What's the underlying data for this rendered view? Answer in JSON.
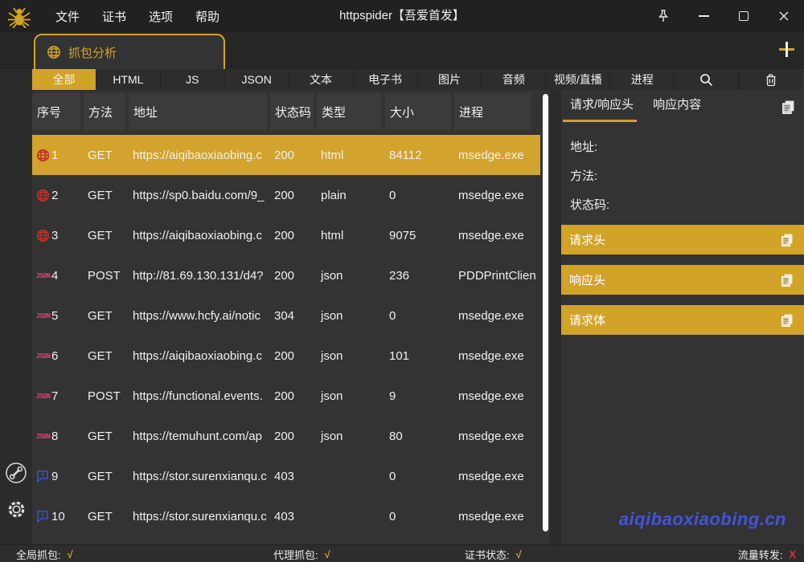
{
  "titlebar": {
    "title": "httpspider【吾爱首发】",
    "menu_items": [
      "文件",
      "证书",
      "选项",
      "帮助"
    ]
  },
  "tabs": {
    "capture_tab": "抓包分析",
    "add_tab": "+"
  },
  "filterbar": {
    "items": [
      "全部",
      "HTML",
      "JS",
      "JSON",
      "文本",
      "电子书",
      "图片",
      "音频",
      "视频/直播",
      "进程"
    ],
    "active": "全部"
  },
  "table": {
    "headers": [
      "序号",
      "方法",
      "地址",
      "状态码",
      "类型",
      "大小",
      "进程"
    ],
    "rows": [
      {
        "icon": "globe",
        "no": "1",
        "method": "GET",
        "url": "https://aiqibaoxiaobing.c",
        "status": "200",
        "type": "html",
        "size": "84112",
        "process": "msedge.exe",
        "selected": true
      },
      {
        "icon": "globe",
        "no": "2",
        "method": "GET",
        "url": "https://sp0.baidu.com/9_",
        "status": "200",
        "type": "plain",
        "size": "0",
        "process": "msedge.exe",
        "selected": false
      },
      {
        "icon": "globe",
        "no": "3",
        "method": "GET",
        "url": "https://aiqibaoxiaobing.c",
        "status": "200",
        "type": "html",
        "size": "9075",
        "process": "msedge.exe",
        "selected": false
      },
      {
        "icon": "json",
        "no": "4",
        "method": "POST",
        "url": "http://81.69.130.131/d4?",
        "status": "200",
        "type": "json",
        "size": "236",
        "process": "PDDPrintClien",
        "selected": false
      },
      {
        "icon": "json",
        "no": "5",
        "method": "GET",
        "url": "https://www.hcfy.ai/notic",
        "status": "304",
        "type": "json",
        "size": "0",
        "process": "msedge.exe",
        "selected": false
      },
      {
        "icon": "json",
        "no": "6",
        "method": "GET",
        "url": "https://aiqibaoxiaobing.c",
        "status": "200",
        "type": "json",
        "size": "101",
        "process": "msedge.exe",
        "selected": false
      },
      {
        "icon": "json",
        "no": "7",
        "method": "POST",
        "url": "https://functional.events.",
        "status": "200",
        "type": "json",
        "size": "9",
        "process": "msedge.exe",
        "selected": false
      },
      {
        "icon": "json",
        "no": "8",
        "method": "GET",
        "url": "https://temuhunt.com/ap",
        "status": "200",
        "type": "json",
        "size": "80",
        "process": "msedge.exe",
        "selected": false
      },
      {
        "icon": "question",
        "no": "9",
        "method": "GET",
        "url": "https://stor.surenxianqu.c",
        "status": "403",
        "type": "",
        "size": "0",
        "process": "msedge.exe",
        "selected": false
      },
      {
        "icon": "question",
        "no": "10",
        "method": "GET",
        "url": "https://stor.surenxianqu.c",
        "status": "403",
        "type": "",
        "size": "0",
        "process": "msedge.exe",
        "selected": false
      }
    ]
  },
  "detail_panel": {
    "tabs": [
      "请求/响应头",
      "响应内容"
    ],
    "active_tab": "请求/响应头",
    "fields": [
      {
        "label": "地址:",
        "value": ""
      },
      {
        "label": "方法:",
        "value": ""
      },
      {
        "label": "状态码:",
        "value": ""
      }
    ],
    "buttons": [
      "请求头",
      "响应头",
      "请求体"
    ],
    "watermark": "aiqibaoxiaobing.cn"
  },
  "statusbar": {
    "items": [
      {
        "label": "全局抓包:",
        "value": "√",
        "state": "ok"
      },
      {
        "label": "代理抓包:",
        "value": "√",
        "state": "ok"
      },
      {
        "label": "证书状态:",
        "value": "√",
        "state": "ok"
      },
      {
        "label": "流量转发:",
        "value": "X",
        "state": "fail"
      }
    ]
  },
  "colors": {
    "accent_gold": "#d2a329",
    "row_globe_red": "#c03028",
    "json_pink": "#e8447c",
    "question_blue": "#3a52d0",
    "watermark_blue": "#4254dd",
    "status_ok": "#d2a329",
    "status_fail": "#e03131"
  }
}
